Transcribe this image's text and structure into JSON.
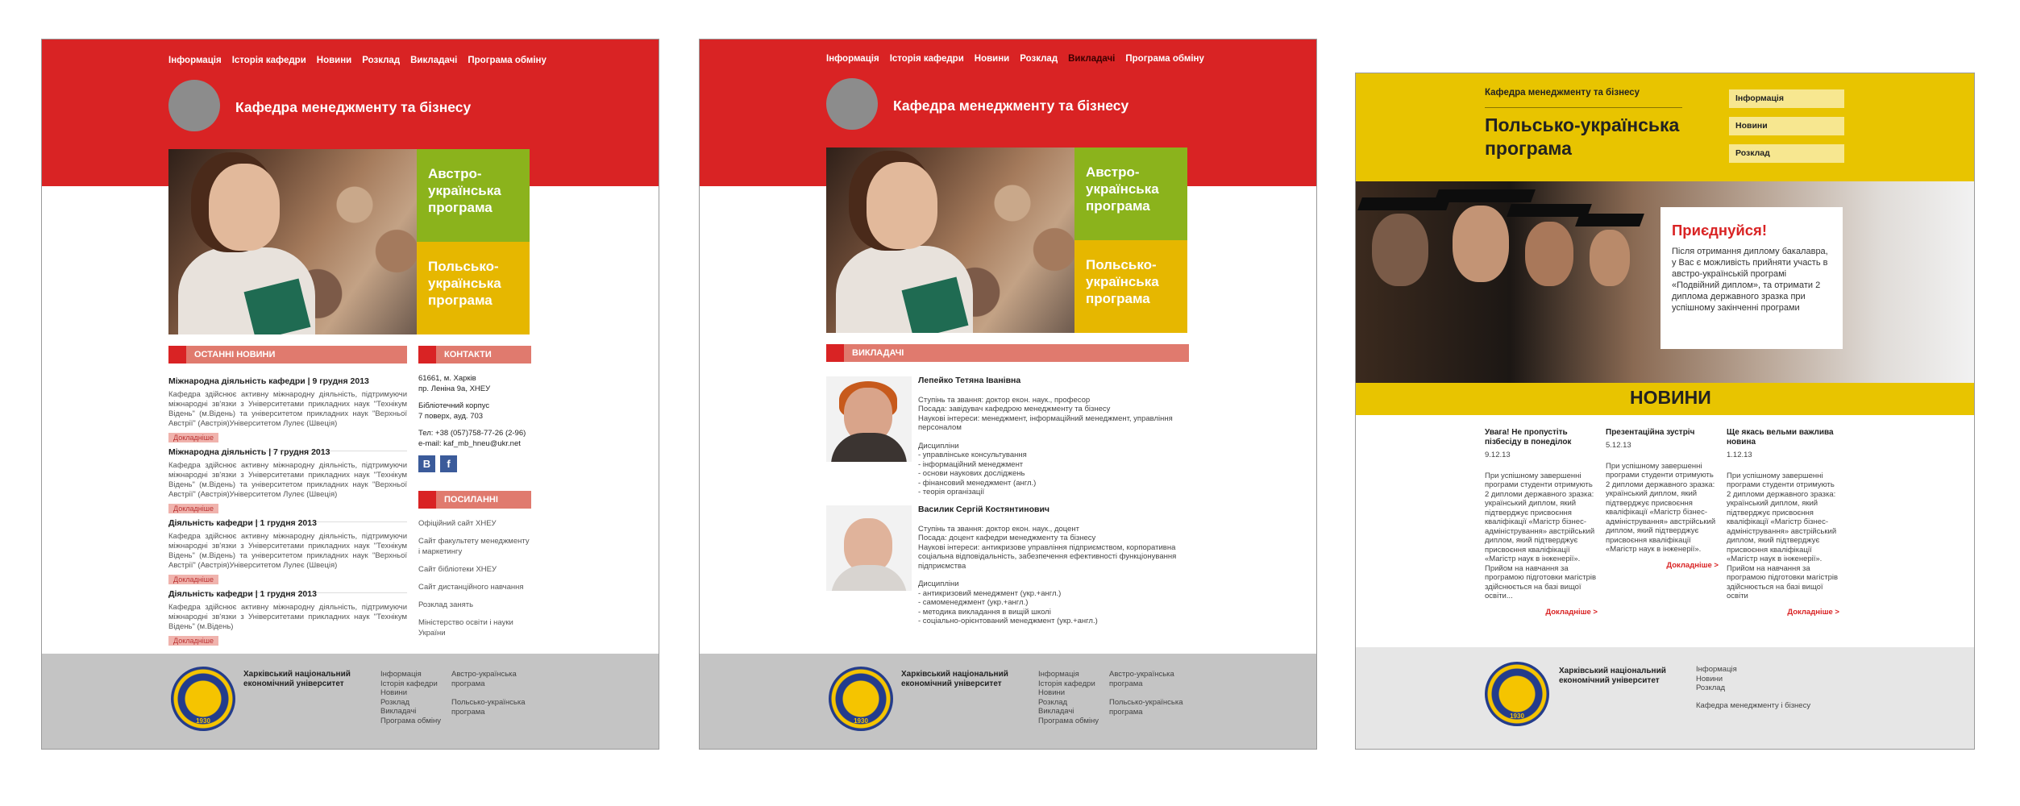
{
  "nav": [
    "Інформація",
    "Історія кафедри",
    "Новини",
    "Розклад",
    "Викладачі",
    "Програма обміну"
  ],
  "department": "Кафедра менеджменту та бізнесу",
  "tiles": {
    "austro": "Австро-українська програма",
    "polish": "Польсько-українська програма"
  },
  "news_header": "ОСТАННІ НОВИНИ",
  "news": [
    {
      "title": "Міжнародна діяльність кафедри   |   9 грудня 2013",
      "body": "Кафедра здійснює активну міжнародну діяльність, підтримуючи міжнародні зв'язки з Університетами прикладних наук \"Технікум Відень\" (м.Відень) та університетом прикладних наук \"Верхньої Австрії\" (Австрія)Університетом Лулеє (Швеція)"
    },
    {
      "title": "Міжнародна діяльність   |   7 грудня 2013",
      "body": "Кафедра здійснює активну міжнародну діяльність, підтримуючи міжнародні зв'язки з Університетами прикладних наук \"Технікум Відень\" (м.Відень) та університетом прикладних наук \"Верхньої Австрії\" (Австрія)Університетом Лулеє (Швеція)"
    },
    {
      "title": "Діяльність кафедри   |   1 грудня 2013",
      "body": "Кафедра здійснює активну міжнародну діяльність, підтримуючи міжнародні зв'язки з Університетами прикладних наук \"Технікум Відень\" (м.Відень) та університетом прикладних наук \"Верхньої Австрії\" (Австрія)Університетом Лулеє (Швеція)"
    },
    {
      "title": "Діяльність кафедри   |   1 грудня 2013",
      "body": "Кафедра здійснює активну міжнародну діяльність, підтримуючи міжнародні зв'язки з Університетами прикладних наук \"Технікум Відень\" (м.Відень)"
    }
  ],
  "more_label": "Докладніше",
  "contacts_header": "КОНТАКТИ",
  "contacts": {
    "addr1": "61661, м. Харків",
    "addr2": "пр. Леніна 9а, ХНЕУ",
    "building1": "Бібліотечний корпус",
    "building2": "7 поверх, ауд. 703",
    "tel": "Тел: +38 (057)758-77-26 (2-96)",
    "email": "e-mail: kaf_mb_hneu@ukr.net"
  },
  "social": {
    "vk": "В",
    "fb": "f"
  },
  "links_header": "ПОСИЛАННІ",
  "links": [
    "Офіційний сайт ХНЕУ",
    "Сайт факультету менеджменту і маркетингу",
    "Сайт бібліотеки ХНЕУ",
    "Сайт дистанційного навчання",
    "Розклад занять",
    "Міністерство освіти і науки України"
  ],
  "footer": {
    "university": "Харківський національний економічний університет",
    "seal_year": "1930",
    "col1": [
      "Інформація",
      "Історія кафедри",
      "Новини",
      "Розклад",
      "Викладачі",
      "Програма обміну"
    ],
    "col2a": "Австро-українська програма",
    "col2b": "Польсько-українська програма",
    "f3_links": [
      "Інформація",
      "Новини",
      "Розклад"
    ],
    "f3_dept": "Кафедра менеджменту і бізнесу"
  },
  "teachers_header": "ВИКЛАДАЧІ",
  "teachers": [
    {
      "name": "Лепейко Тетяна Іванівна",
      "degree": "Ступінь та звання: доктор екон. наук., професор",
      "position": "Посада: завідувач кафедрою менеджменту та бізнесу",
      "interests": "Наукові інтереси: менеджмент, інформаційний менеджмент, управління персоналом",
      "disc_title": "Дисципліни",
      "disc": [
        "- управлінське консультування",
        "- інформаційний менеджмент",
        "- основи наукових досліджень",
        "- фінансовий менеджмент (англ.)",
        "- теорія організації"
      ]
    },
    {
      "name": "Василик Сергій Костянтинович",
      "degree": "Ступінь та звання: доктор екон. наук., доцент",
      "position": "Посада: доцент кафедри менеджменту та бізнесу",
      "interests": "Наукові інтереси: антикризове управління підприємством, корпоративна соціальна відповідальність, забезпечення ефективності функціонування підприємства",
      "disc_title": "Дисципліни",
      "disc": [
        "- антикризовий менеджмент (укр.+англ.)",
        "- самоменеджмент (укр.+англ.)",
        "- методика викладання в вищій школі",
        "- соціально-орієнтований менеджмент (укр.+англ.)"
      ]
    }
  ],
  "f3": {
    "dept": "Кафедра менеджменту та бізнесу",
    "title": "Польсько-українська програма",
    "menu": [
      "Інформація",
      "Новини",
      "Розклад"
    ],
    "cta_title": "Приєднуйся!",
    "cta_text": "Після отримання диплому бакалавра, у Вас є можливість прийняти участь в австро-українській програмі «Подвійний диплом», та отримати 2 диплома державного зразка при успішному закінченні програми",
    "news_label": "НОВИНИ",
    "news": [
      {
        "title": "Увага! Не пропустіть пізбесіду в понеділок",
        "date": "9.12.13",
        "body": "При успішному завершенні програми студенти отримують 2 дипломи державного зразка: український диплом, який підтверджує присвоєння кваліфікації «Магістр бізнес-адміністрування» австрійський диплом, який підтверджує присвоєння кваліфікації «Магістр наук в інженерії». Прийом на навчання за програмою підготовки магістрів здійснюється на базі вищої освіти..."
      },
      {
        "title": "Презентаційна зустріч",
        "date": "5.12.13",
        "body": "При успішному завершенні програми студенти отримують 2 дипломи державного зразка: український диплом, який підтверджує присвоєння кваліфікації «Магістр бізнес-адміністрування» австрійський диплом, який підтверджує присвоєння кваліфікації «Магістр наук в інженерії»."
      },
      {
        "title": "Ще якась вельми важлива новина",
        "date": "1.12.13",
        "body": "При успішному завершенні програми студенти отримують 2 дипломи державного зразка: український диплом, який підтверджує присвоєння кваліфікації «Магістр бізнес-адміністрування» австрійський диплом, який підтверджує присвоєння кваліфікації «Магістр наук в інженерії». Прийом на навчання за програмою підготовки магістрів здійснюється на базі вищої освіти"
      }
    ],
    "more": "Докладніше >"
  },
  "colors": {
    "red": "#d92324",
    "yellow": "#e8c400",
    "green": "#8bb31c",
    "footer_gray": "#c4c4c4"
  }
}
